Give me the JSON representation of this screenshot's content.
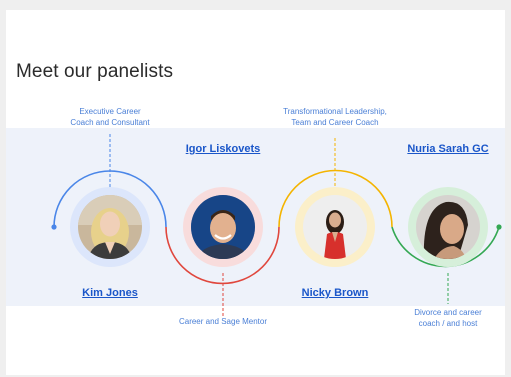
{
  "title": "Meet our panelists",
  "colors": {
    "blue": "#4a86e8",
    "red": "#e0473d",
    "yellow": "#f4b400",
    "green": "#34a853",
    "link": "#1a56c9",
    "role_text": "#4a7fd6"
  },
  "panelists": [
    {
      "name": "Kim Jones",
      "role_line1": "Executive Career",
      "role_line2": "Coach and Consultant",
      "ring_color": "#4a86e8"
    },
    {
      "name": "Igor Liskovets",
      "role_line1": "Career and Sage Mentor",
      "role_line2": "",
      "ring_color": "#e0473d"
    },
    {
      "name": "Nicky Brown",
      "role_line1": "Transformational Leadership,",
      "role_line2": "Team and Career Coach",
      "ring_color": "#f4b400"
    },
    {
      "name": "Nuria Sarah GC",
      "role_line1": "Divorce and career",
      "role_line2": "coach / and host",
      "ring_color": "#34a853"
    }
  ]
}
